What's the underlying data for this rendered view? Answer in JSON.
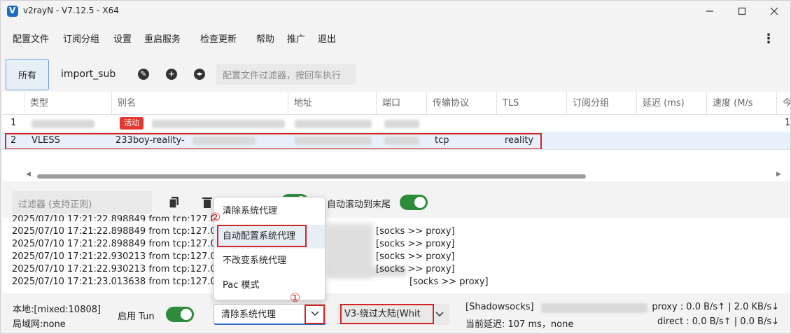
{
  "window": {
    "title": "v2rayN - V7.12.5 - X64",
    "minimize_icon": "minimize-icon",
    "maximize_icon": "maximize-icon",
    "close_icon": "close-icon"
  },
  "menu": {
    "items": [
      "配置文件",
      "订阅分组",
      "设置",
      "重启服务",
      "检查更新",
      "帮助",
      "推广",
      "退出"
    ]
  },
  "groups": {
    "all_label": "所有",
    "sub_label": "import_sub",
    "filter_placeholder": "配置文件过滤器，按回车执行"
  },
  "table": {
    "columns": [
      "类型",
      "别名",
      "地址",
      "端口",
      "传输协议",
      "TLS",
      "订阅分组",
      "延迟 (ms)",
      "速度 (M/s",
      "今"
    ],
    "rows": [
      {
        "index": "1",
        "type": "",
        "badge": "活动",
        "alias": "",
        "address": "",
        "port": "",
        "transport": "",
        "tls": "",
        "extra": "1"
      },
      {
        "index": "2",
        "type": "VLESS",
        "badge": "",
        "alias": "233boy-reality-",
        "address": "",
        "port": "",
        "transport": "tcp",
        "tls": "reality",
        "extra": ""
      }
    ]
  },
  "log": {
    "filter_placeholder": "过滤器 (支持正则)",
    "auto_scroll_label": "自动滚动到末尾",
    "lines": [
      {
        "prefix": "2025/07/10 17:21:22.898849 from tcp:127.0",
        "suffix": "[socks >> proxy]"
      },
      {
        "prefix": "2025/07/10 17:21:22.898849 from tcp:127.0",
        "suffix": "[socks >> proxy]"
      },
      {
        "prefix": "2025/07/10 17:21:22.930213 from tcp:127.0",
        "suffix": "[socks >> proxy]"
      },
      {
        "prefix": "2025/07/10 17:21:22.930213 from tcp:127.0",
        "suffix": "[socks >> proxy]"
      },
      {
        "prefix": "2025/07/10 17:21:23.013638 from tcp:127.0",
        "suffix": "[socks >> proxy]"
      }
    ],
    "partial_first_line": "2025/07/10 17:21:22.898849 from tcp:127.0"
  },
  "proxy_popup": {
    "options": [
      "清除系统代理",
      "自动配置系统代理",
      "不改变系统代理",
      "Pac 模式"
    ],
    "marker_1": "①",
    "marker_2": "②"
  },
  "status": {
    "local": "本地:[mixed:10808]",
    "lan": "局域网:none",
    "tun_label": "启用 Tun",
    "proxy_mode_selected": "清除系统代理",
    "routing_selected": "V3-绕过大陆(Whit",
    "server_type": "[Shadowsocks]",
    "latency": "当前延迟: 107 ms，none",
    "proxy_speed": "proxy : 0.0 B/s↑ | 2.0 KB/s↓",
    "direct_speed": "direct : 0.0 B/s↑ | 0.0 B/s↓"
  },
  "colors": {
    "accent_green": "#2e8b3c",
    "annotation_red": "#d32424",
    "active_badge": "#e2382f"
  }
}
